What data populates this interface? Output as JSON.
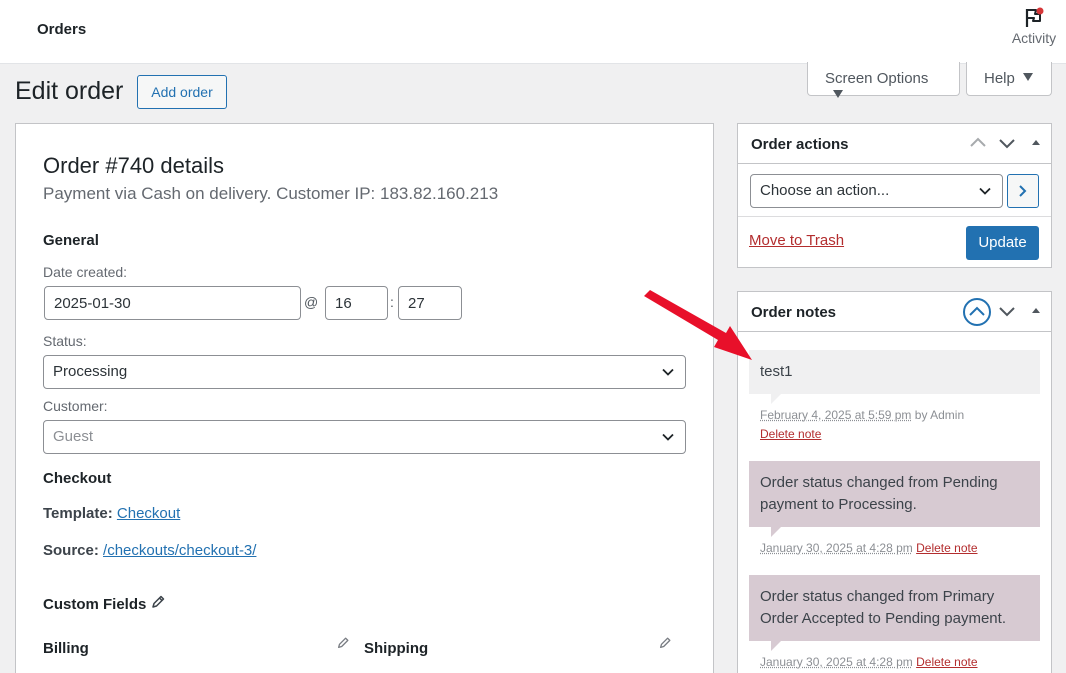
{
  "topbar": {
    "title": "Orders",
    "activity_label": "Activity"
  },
  "screen_options": {
    "screen_label": "Screen Options",
    "help_label": "Help"
  },
  "page": {
    "title": "Edit order",
    "add_order_label": "Add order"
  },
  "order": {
    "heading": "Order #740 details",
    "subheading": "Payment via Cash on delivery. Customer IP: 183.82.160.213",
    "general_label": "General",
    "date_created_label": "Date created:",
    "date_value": "2025-01-30",
    "at_symbol": "@",
    "hour_value": "16",
    "colon": ":",
    "minute_value": "27",
    "status_label": "Status:",
    "status_value": "Processing",
    "customer_label": "Customer:",
    "customer_value": "Guest",
    "checkout_label": "Checkout",
    "template_label": "Template:",
    "template_link": "Checkout",
    "source_label": "Source:",
    "source_link": "/checkouts/checkout-3/",
    "custom_fields_label": "Custom Fields",
    "billing_label": "Billing",
    "shipping_label": "Shipping"
  },
  "order_actions": {
    "title": "Order actions",
    "select_value": "Choose an action...",
    "trash_label": "Move to Trash",
    "update_label": "Update"
  },
  "order_notes": {
    "title": "Order notes",
    "notes": [
      {
        "text": "test1",
        "date": "February 4, 2025 at 5:59 pm",
        "by": "by Admin",
        "delete": "Delete note"
      },
      {
        "text": "Order status changed from Pending payment to Processing.",
        "date": "January 30, 2025 at 4:28 pm",
        "delete": "Delete note"
      },
      {
        "text": "Order status changed from Primary Order Accepted to Pending payment.",
        "date": "January 30, 2025 at 4:28 pm",
        "delete": "Delete note"
      }
    ]
  },
  "colors": {
    "accent": "#2271b1",
    "danger": "#b32d2e",
    "note_system": "#d7cad2",
    "arrow": "#e8102a"
  }
}
